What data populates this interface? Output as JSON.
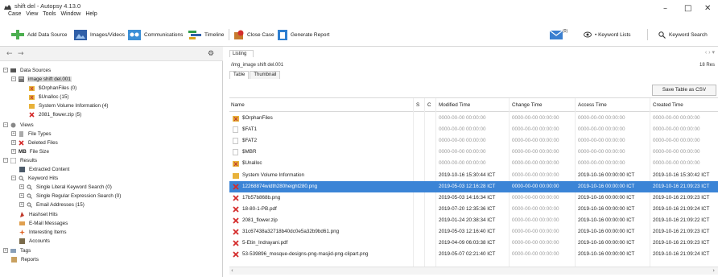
{
  "window": {
    "title": "shift del - Autopsy 4.13.0",
    "menu": [
      "Case",
      "View",
      "Tools",
      "Window",
      "Help"
    ]
  },
  "toolbar": {
    "add_data_source": "Add Data Source",
    "images_videos": "Images/Videos",
    "communications": "Communications",
    "timeline": "Timeline",
    "close_case": "Close Case",
    "generate_report": "Generate Report",
    "mail_badge": "(0)",
    "keyword_lists": "• Keyword Lists",
    "keyword_search": "Keyword Search"
  },
  "tree": {
    "data_sources": "Data Sources",
    "image": "image shift del.001",
    "orphan_files": "$OrphanFiles (0)",
    "unalloc": "$Unalloc (15)",
    "system_volume": "System Volume Information (4)",
    "zip": "2081_flower.zip (5)",
    "views": "Views",
    "file_types": "File Types",
    "deleted_files": "Deleted Files",
    "mb": "MB",
    "file_size": "File Size",
    "results": "Results",
    "extracted_content": "Extracted Content",
    "keyword_hits": "Keyword Hits",
    "single_literal": "Single Literal Keyword Search (0)",
    "single_regex": "Single Regular Expression Search (0)",
    "email_addresses": "Email Addresses (15)",
    "hashset_hits": "Hashset Hits",
    "email_messages": "E-Mail Messages",
    "interesting_items": "Interesting Items",
    "accounts": "Accounts",
    "tags": "Tags",
    "reports": "Reports"
  },
  "listing": {
    "tab_label": "Listing",
    "path": "/img_image shift del.001",
    "results_count": "18 Res",
    "subtabs": [
      "Table",
      "Thumbnail"
    ],
    "save_button": "Save Table as CSV"
  },
  "table": {
    "headers": [
      "Name",
      "S",
      "C",
      "Modified Time",
      "Change Time",
      "Access Time",
      "Created Time"
    ],
    "rows": [
      {
        "name": "$OrphanFiles",
        "icon": "folder-orphan",
        "mod": "0000-00-00 00:00:00",
        "chg": "0000-00-00 00:00:00",
        "acc": "0000-00-00 00:00:00",
        "cre": "0000-00-00 00:00:00"
      },
      {
        "name": "$FAT1",
        "icon": "file",
        "mod": "0000-00-00 00:00:00",
        "chg": "0000-00-00 00:00:00",
        "acc": "0000-00-00 00:00:00",
        "cre": "0000-00-00 00:00:00"
      },
      {
        "name": "$FAT2",
        "icon": "file",
        "mod": "0000-00-00 00:00:00",
        "chg": "0000-00-00 00:00:00",
        "acc": "0000-00-00 00:00:00",
        "cre": "0000-00-00 00:00:00"
      },
      {
        "name": "$MBR",
        "icon": "file",
        "mod": "0000-00-00 00:00:00",
        "chg": "0000-00-00 00:00:00",
        "acc": "0000-00-00 00:00:00",
        "cre": "0000-00-00 00:00:00"
      },
      {
        "name": "$Unalloc",
        "icon": "folder-orphan",
        "mod": "0000-00-00 00:00:00",
        "chg": "0000-00-00 00:00:00",
        "acc": "0000-00-00 00:00:00",
        "cre": "0000-00-00 00:00:00"
      },
      {
        "name": "System Volume Information",
        "icon": "folder",
        "mod": "2019-10-16 15:30:44 ICT",
        "chg": "0000-00-00 00:00:00",
        "acc": "2019-10-16 00:00:00 ICT",
        "cre": "2019-10-16 15:30:42 ICT"
      },
      {
        "name": "12268874width280height280.png",
        "icon": "deleted",
        "mod": "2019-05-03 12:16:28 ICT",
        "chg": "0000-00-00 00:00:00",
        "acc": "2019-10-16 00:00:00 ICT",
        "cre": "2019-10-16 21:09:23 ICT",
        "selected": true
      },
      {
        "name": "17b57b868b.png",
        "icon": "deleted",
        "mod": "2019-05-03 14:16:34 ICT",
        "chg": "0000-00-00 00:00:00",
        "acc": "2019-10-16 00:00:00 ICT",
        "cre": "2019-10-16 21:09:23 ICT"
      },
      {
        "name": "18-80-1-PB.pdf",
        "icon": "deleted",
        "mod": "2019-07-20 12:35:36 ICT",
        "chg": "0000-00-00 00:00:00",
        "acc": "2019-10-16 00:00:00 ICT",
        "cre": "2019-10-16 21:09:24 ICT"
      },
      {
        "name": "2081_flower.zip",
        "icon": "deleted",
        "mod": "2019-01-24 20:38:34 ICT",
        "chg": "0000-00-00 00:00:00",
        "acc": "2019-10-16 00:00:00 ICT",
        "cre": "2019-10-16 21:09:22 ICT"
      },
      {
        "name": "31c67438a32718b40dc0e5a32b9bd61.png",
        "icon": "deleted",
        "mod": "2019-05-03 12:16:40 ICT",
        "chg": "0000-00-00 00:00:00",
        "acc": "2019-10-16 00:00:00 ICT",
        "cre": "2019-10-16 21:09:23 ICT"
      },
      {
        "name": "5-Etin_Indrayani.pdf",
        "icon": "deleted",
        "mod": "2019-04-09 06:03:38 ICT",
        "chg": "0000-00-00 00:00:00",
        "acc": "2019-10-16 00:00:00 ICT",
        "cre": "2019-10-16 21:09:23 ICT"
      },
      {
        "name": "53-539896_mosque-designs-png-masjid-png-clipart.png",
        "icon": "deleted",
        "mod": "2019-05-07 02:21:40 ICT",
        "chg": "0000-00-00 00:00:00",
        "acc": "2019-10-16 00:00:00 ICT",
        "cre": "2019-10-16 21:09:24 ICT"
      }
    ]
  },
  "colors": {
    "selection": "#3b84d6",
    "deleted_red": "#d42a2a",
    "folder_yellow": "#e8b23a"
  }
}
